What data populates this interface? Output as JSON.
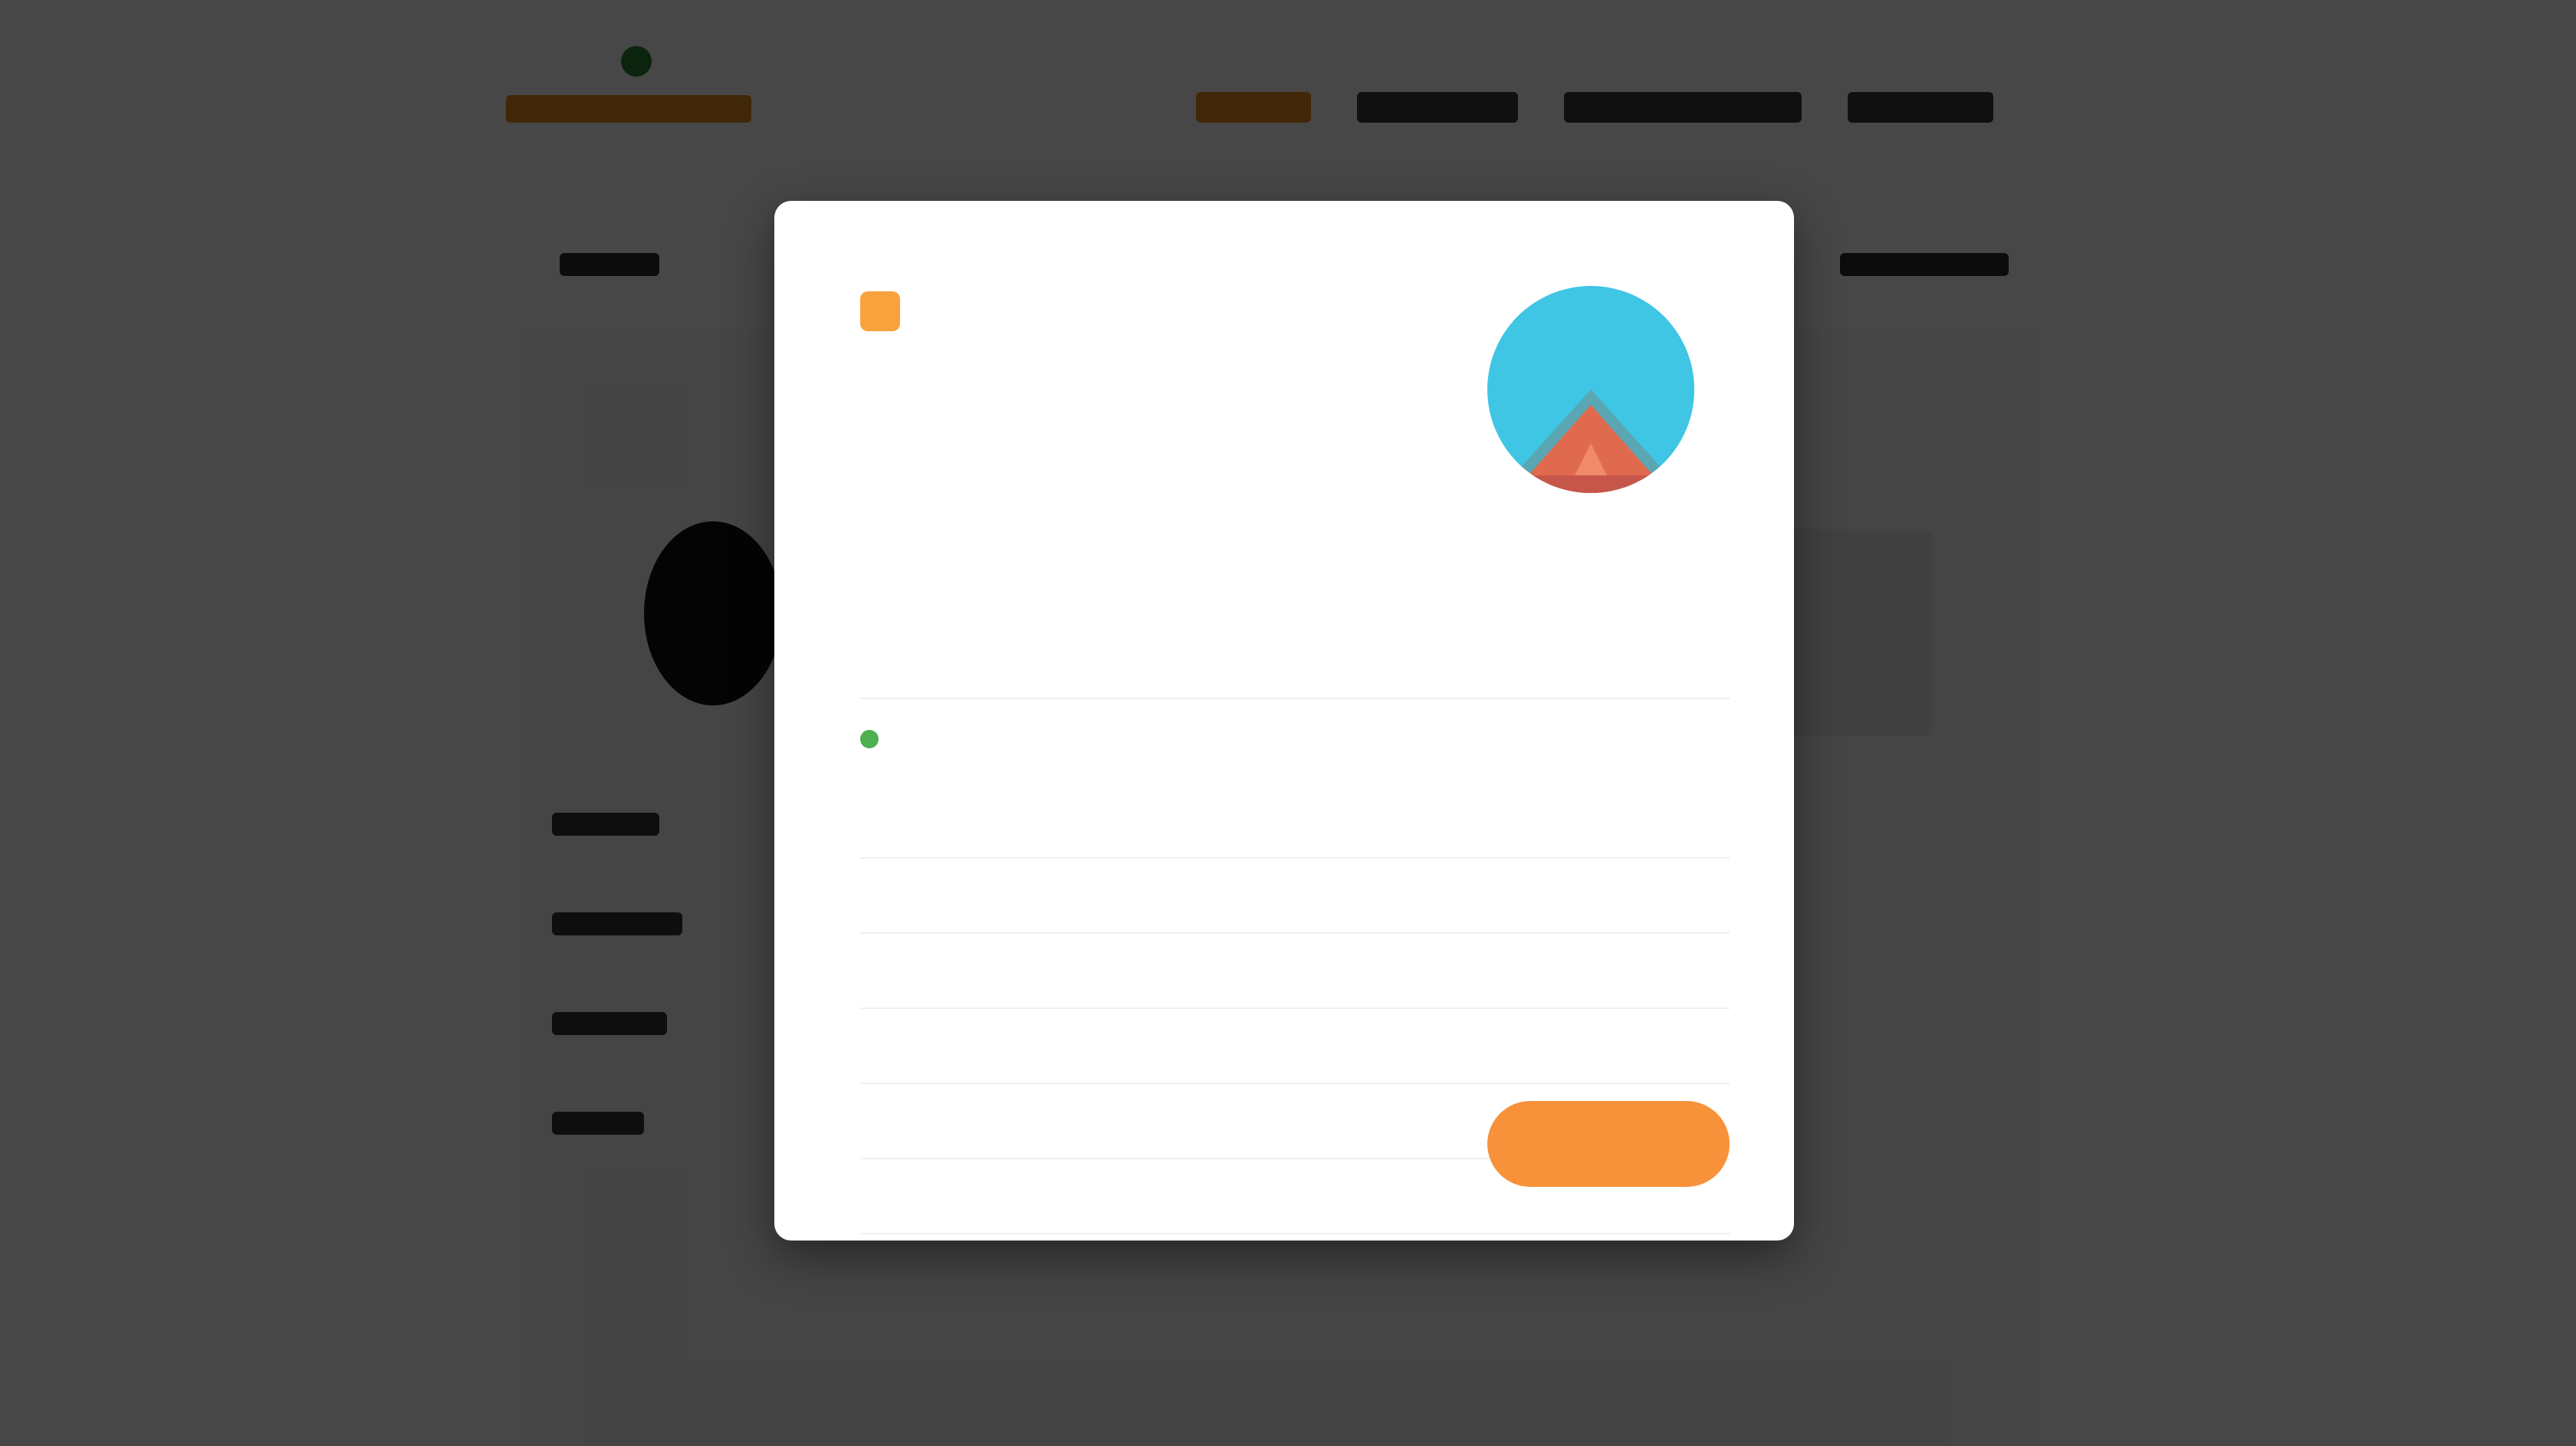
{
  "site": {
    "logo_text": "",
    "nav_items": [
      "",
      "",
      "",
      ""
    ],
    "colors": {
      "brand_orange": "#e08e1b",
      "brand_green": "#2e7d32",
      "accent": "#f7913a"
    }
  },
  "modal": {
    "product": {
      "badge_icon": "product-badge-icon",
      "name": "",
      "line1": "",
      "line2": "",
      "image": "tent-product-image"
    },
    "status": {
      "text": "",
      "color": "#4caf50"
    },
    "details": [
      {
        "label": "",
        "value": ""
      },
      {
        "label": "",
        "value": ""
      },
      {
        "label": "",
        "value": ""
      },
      {
        "label": "",
        "value": ""
      },
      {
        "label": "",
        "value": ""
      },
      {
        "label": "",
        "value": ""
      }
    ],
    "actions": {
      "cancel_label": "",
      "confirm_label": ""
    }
  }
}
